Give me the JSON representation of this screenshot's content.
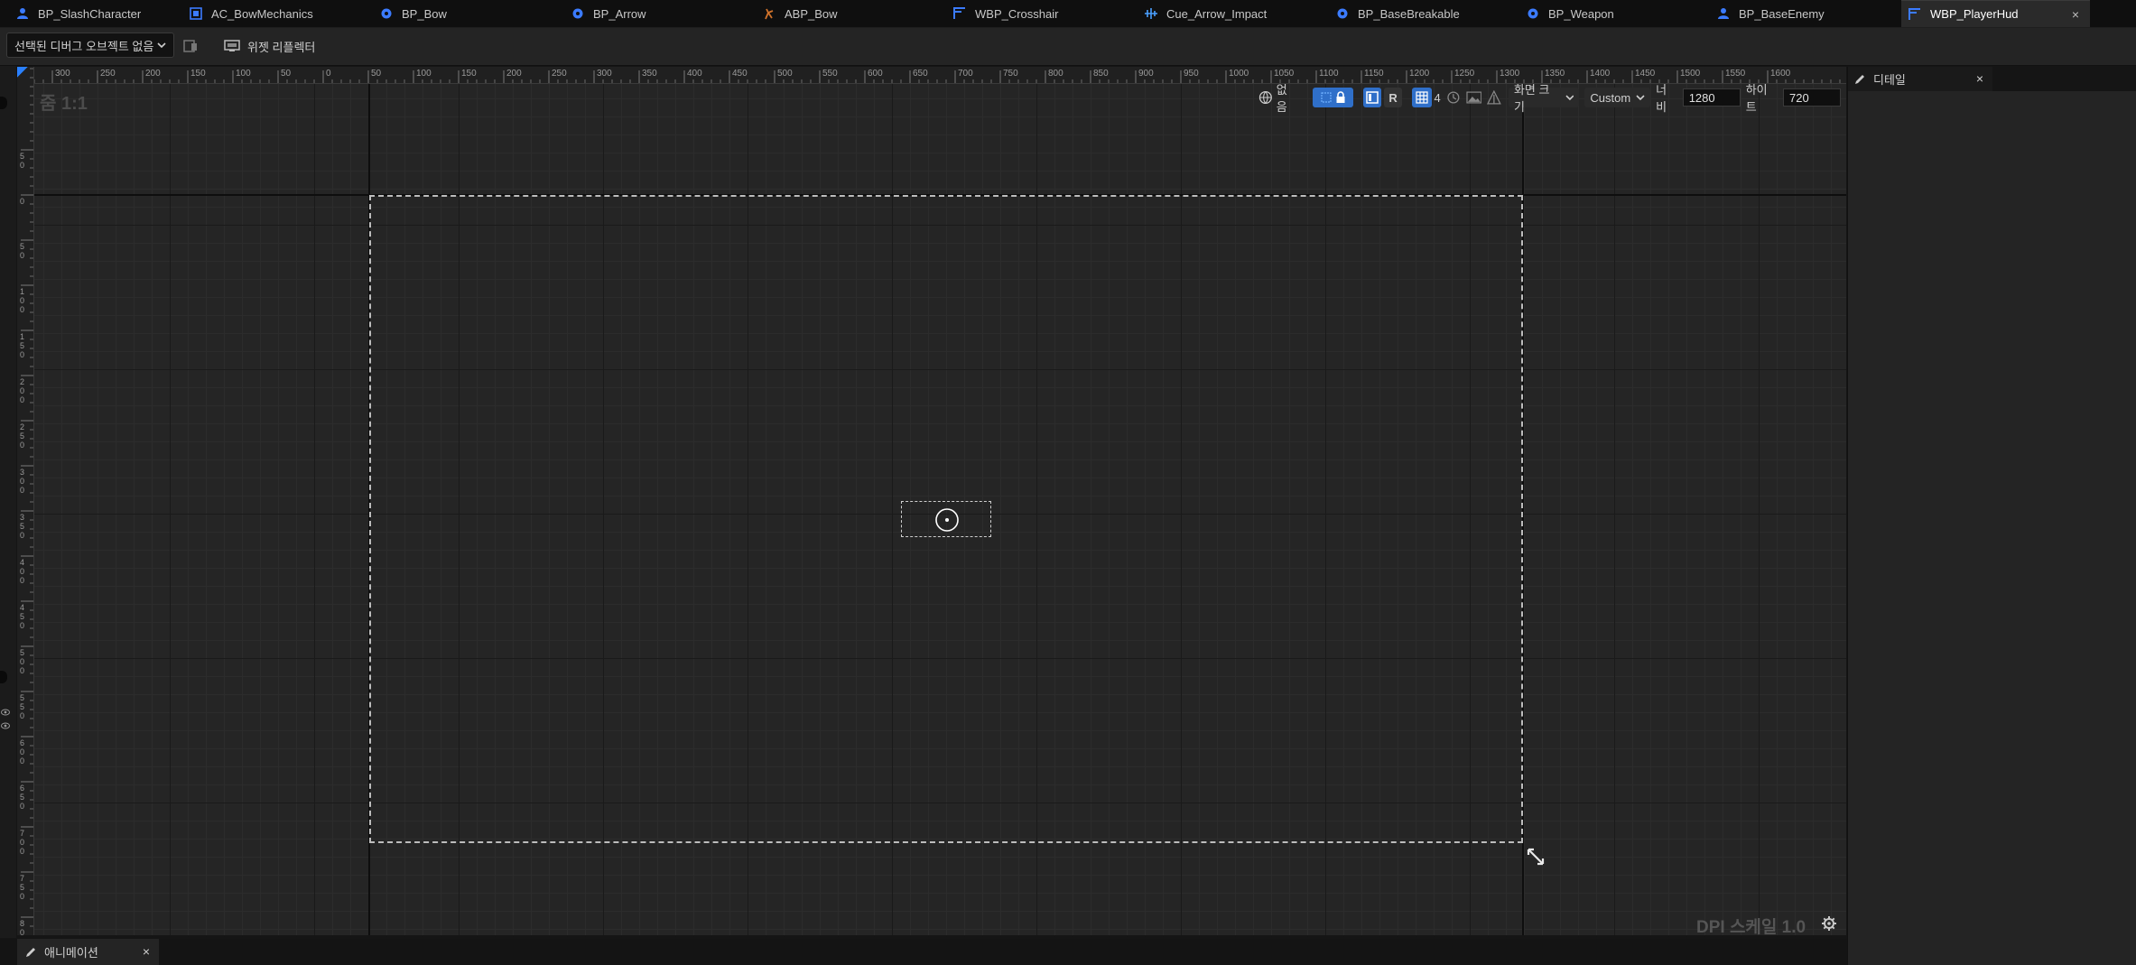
{
  "tabs": [
    {
      "label": "BP_SlashCharacter",
      "icon": "blueprint-person-icon",
      "active": false
    },
    {
      "label": "AC_BowMechanics",
      "icon": "actor-component-icon",
      "active": false
    },
    {
      "label": "BP_Bow",
      "icon": "blueprint-actor-icon",
      "active": false
    },
    {
      "label": "BP_Arrow",
      "icon": "blueprint-actor-icon",
      "active": false
    },
    {
      "label": "ABP_Bow",
      "icon": "anim-blueprint-icon",
      "active": false
    },
    {
      "label": "WBP_Crosshair",
      "icon": "widget-blueprint-icon",
      "active": false
    },
    {
      "label": "Cue_Arrow_Impact",
      "icon": "sound-cue-icon",
      "active": false
    },
    {
      "label": "BP_BaseBreakable",
      "icon": "blueprint-actor-icon",
      "active": false
    },
    {
      "label": "BP_Weapon",
      "icon": "blueprint-actor-icon",
      "active": false
    },
    {
      "label": "BP_BaseEnemy",
      "icon": "blueprint-person-icon",
      "active": false
    },
    {
      "label": "WBP_PlayerHud",
      "icon": "widget-blueprint-icon",
      "active": true,
      "close": "×"
    }
  ],
  "toolbar": {
    "debug_dropdown": "선택된 디버그 오브젝트 없음",
    "widget_reflector": "위젯 리플렉터"
  },
  "designer": {
    "zoom_label": "줌 1:1",
    "dpi_label": "DPI 스케일 1.0",
    "ruler_top_labels": [
      "250",
      "300",
      "250",
      "200",
      "150",
      "100",
      "50",
      "0",
      "50",
      "100",
      "150",
      "200",
      "250",
      "300",
      "350",
      "400",
      "450",
      "500",
      "550",
      "600",
      "650",
      "700",
      "750",
      "800",
      "850",
      "900",
      "950",
      "1000",
      "1050",
      "1100",
      "1150",
      "1200",
      "1250",
      "1300",
      "1350",
      "1400",
      "1450",
      "1500",
      "1550",
      "1600"
    ],
    "ruler_left_labels": [
      "5 0",
      "0",
      "5 0",
      "1 0 0",
      "1 5 0",
      "2 0 0",
      "2 5 0",
      "3 0 0",
      "3 5 0",
      "4 0 0",
      "4 5 0",
      "5 0 0",
      "5 5 0",
      "6 0 0",
      "6 5 0",
      "7 0 0",
      "7 5 0",
      "8 0 0"
    ],
    "tools": {
      "localization": "없음",
      "respect_lock": "R",
      "grid_snap": "4",
      "screen_size": "화면 크기",
      "preset": "Custom",
      "width_label": "너비",
      "width_value": "1280",
      "height_label": "하이트",
      "height_value": "720"
    }
  },
  "details": {
    "title": "디테일",
    "close": "×"
  },
  "bottom": {
    "animation_tab": "애니메이션",
    "close": "×"
  },
  "colors": {
    "accent": "#2f6fc9",
    "background": "#252525",
    "tab_active": "#2a2a2a"
  }
}
